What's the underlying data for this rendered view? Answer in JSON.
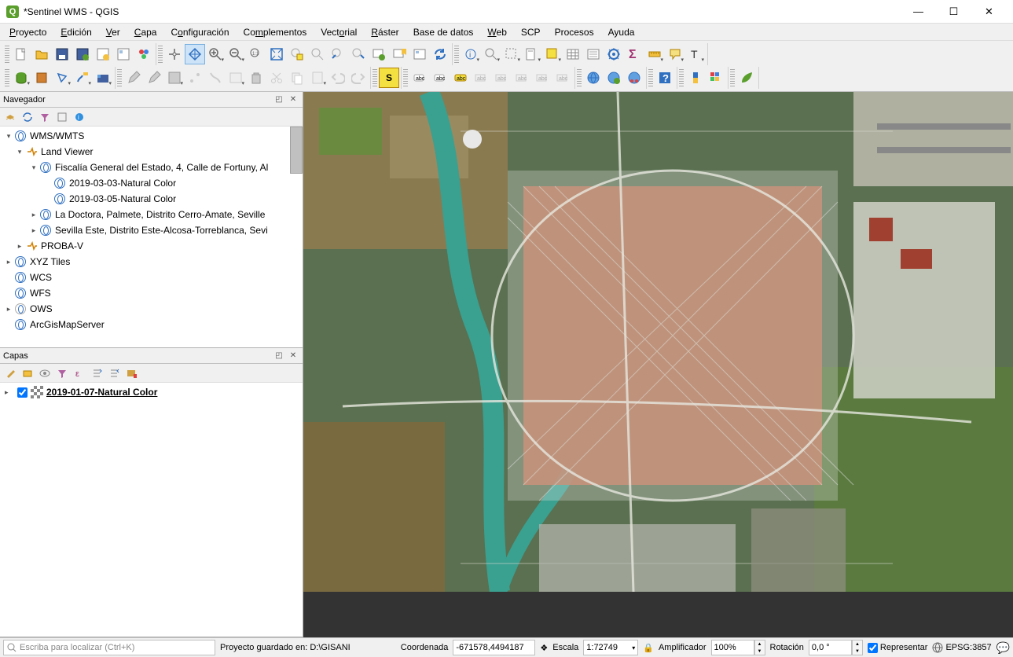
{
  "window": {
    "title": "*Sentinel WMS - QGIS"
  },
  "menu": {
    "proyecto": "Proyecto",
    "edicion": "Edición",
    "ver": "Ver",
    "capa": "Capa",
    "configuracion": "Configuración",
    "complementos": "Complementos",
    "vectorial": "Vectorial",
    "raster": "Ráster",
    "basedatos": "Base de datos",
    "web": "Web",
    "scp": "SCP",
    "procesos": "Procesos",
    "ayuda": "Ayuda"
  },
  "panels": {
    "browser_title": "Navegador",
    "layers_title": "Capas"
  },
  "browser_tree": {
    "wms": "WMS/WMTS",
    "landviewer": "Land Viewer",
    "fiscalia": "Fiscalía General del Estado, 4, Calle de Fortuny, Al",
    "layer1": "2019-03-03-Natural Color",
    "layer2": "2019-03-05-Natural Color",
    "ladoctora": "La Doctora, Palmete, Distrito Cerro-Amate, Seville",
    "sevillaeste": "Sevilla Este, Distrito Este-Alcosa-Torreblanca, Sevi",
    "probav": "PROBA-V",
    "xyz": "XYZ Tiles",
    "wcs": "WCS",
    "wfs": "WFS",
    "ows": "OWS",
    "arcgis": "ArcGisMapServer"
  },
  "layers": {
    "visible_layer": "2019-01-07-Natural Color"
  },
  "statusbar": {
    "locator_placeholder": "Escriba para localizar (Ctrl+K)",
    "project_saved": "Proyecto guardado en: D:\\GISANI",
    "coord_label": "Coordenada",
    "coord_value": "-671578,4494187",
    "scale_label": "Escala",
    "scale_value": "1:72749",
    "amp_label": "Amplificador",
    "amp_value": "100%",
    "rot_label": "Rotación",
    "rot_value": "0,0 °",
    "render_label": "Representar",
    "epsg": "EPSG:3857"
  }
}
